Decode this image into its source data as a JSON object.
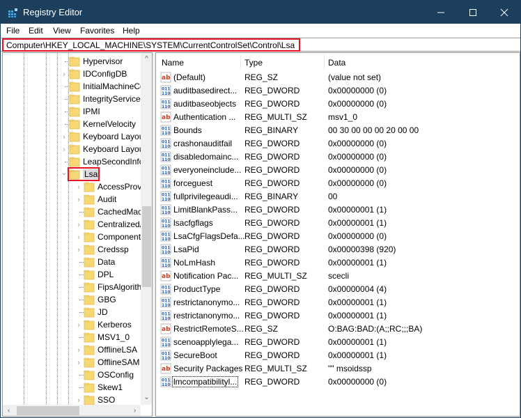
{
  "window": {
    "title": "Registry Editor",
    "controls": {
      "minimize": "minimize",
      "maximize": "maximize",
      "close": "close"
    }
  },
  "menu": [
    "File",
    "Edit",
    "View",
    "Favorites",
    "Help"
  ],
  "address": {
    "path": "Computer\\HKEY_LOCAL_MACHINE\\SYSTEM\\CurrentControlSet\\Control\\Lsa"
  },
  "tree": {
    "items": [
      {
        "label": "Hypervisor",
        "level": 0,
        "expander": "none"
      },
      {
        "label": "IDConfigDB",
        "level": 0,
        "expander": "collapsed"
      },
      {
        "label": "InitialMachineConfig",
        "level": 0,
        "expander": "none"
      },
      {
        "label": "IntegrityServices",
        "level": 0,
        "expander": "none"
      },
      {
        "label": "IPMI",
        "level": 0,
        "expander": "none"
      },
      {
        "label": "KernelVelocity",
        "level": 0,
        "expander": "none"
      },
      {
        "label": "Keyboard Layout",
        "level": 0,
        "expander": "collapsed"
      },
      {
        "label": "Keyboard Layouts",
        "level": 0,
        "expander": "collapsed"
      },
      {
        "label": "LeapSecondInformation",
        "level": 0,
        "expander": "none"
      },
      {
        "label": "Lsa",
        "level": 0,
        "expander": "expanded",
        "selected": true
      },
      {
        "label": "AccessProviders",
        "level": 1,
        "expander": "collapsed"
      },
      {
        "label": "Audit",
        "level": 1,
        "expander": "collapsed"
      },
      {
        "label": "CachedMachineNames",
        "level": 1,
        "expander": "none"
      },
      {
        "label": "CentralizedAccessPolicies",
        "level": 1,
        "expander": "collapsed"
      },
      {
        "label": "ComponentUpdates",
        "level": 1,
        "expander": "collapsed"
      },
      {
        "label": "Credssp",
        "level": 1,
        "expander": "collapsed"
      },
      {
        "label": "Data",
        "level": 1,
        "expander": "none"
      },
      {
        "label": "DPL",
        "level": 1,
        "expander": "none"
      },
      {
        "label": "FipsAlgorithmPolicy",
        "level": 1,
        "expander": "none"
      },
      {
        "label": "GBG",
        "level": 1,
        "expander": "none"
      },
      {
        "label": "JD",
        "level": 1,
        "expander": "none"
      },
      {
        "label": "Kerberos",
        "level": 1,
        "expander": "collapsed"
      },
      {
        "label": "MSV1_0",
        "level": 1,
        "expander": "none"
      },
      {
        "label": "OfflineLSA",
        "level": 1,
        "expander": "collapsed"
      },
      {
        "label": "OfflineSAM",
        "level": 1,
        "expander": "collapsed"
      },
      {
        "label": "OSConfig",
        "level": 1,
        "expander": "none"
      },
      {
        "label": "Skew1",
        "level": 1,
        "expander": "none"
      },
      {
        "label": "SSO",
        "level": 1,
        "expander": "collapsed"
      }
    ]
  },
  "values": {
    "columns": {
      "name": "Name",
      "type": "Type",
      "data": "Data"
    },
    "rows": [
      {
        "icon": "string",
        "name": "(Default)",
        "type": "REG_SZ",
        "data": "(value not set)"
      },
      {
        "icon": "binary",
        "name": "auditbasedirect...",
        "type": "REG_DWORD",
        "data": "0x00000000 (0)"
      },
      {
        "icon": "binary",
        "name": "auditbaseobjects",
        "type": "REG_DWORD",
        "data": "0x00000000 (0)"
      },
      {
        "icon": "string",
        "name": "Authentication ...",
        "type": "REG_MULTI_SZ",
        "data": "msv1_0"
      },
      {
        "icon": "binary",
        "name": "Bounds",
        "type": "REG_BINARY",
        "data": "00 30 00 00 00 20 00 00"
      },
      {
        "icon": "binary",
        "name": "crashonauditfail",
        "type": "REG_DWORD",
        "data": "0x00000000 (0)"
      },
      {
        "icon": "binary",
        "name": "disabledomainc...",
        "type": "REG_DWORD",
        "data": "0x00000000 (0)"
      },
      {
        "icon": "binary",
        "name": "everyoneinclude...",
        "type": "REG_DWORD",
        "data": "0x00000000 (0)"
      },
      {
        "icon": "binary",
        "name": "forceguest",
        "type": "REG_DWORD",
        "data": "0x00000000 (0)"
      },
      {
        "icon": "binary",
        "name": "fullprivilegeaudi...",
        "type": "REG_BINARY",
        "data": "00"
      },
      {
        "icon": "binary",
        "name": "LimitBlankPass...",
        "type": "REG_DWORD",
        "data": "0x00000001 (1)"
      },
      {
        "icon": "binary",
        "name": "lsacfgflags",
        "type": "REG_DWORD",
        "data": "0x00000001 (1)"
      },
      {
        "icon": "binary",
        "name": "LsaCfgFlagsDefa...",
        "type": "REG_DWORD",
        "data": "0x00000000 (0)"
      },
      {
        "icon": "binary",
        "name": "LsaPid",
        "type": "REG_DWORD",
        "data": "0x00000398 (920)"
      },
      {
        "icon": "binary",
        "name": "NoLmHash",
        "type": "REG_DWORD",
        "data": "0x00000001 (1)"
      },
      {
        "icon": "string",
        "name": "Notification Pac...",
        "type": "REG_MULTI_SZ",
        "data": "scecli"
      },
      {
        "icon": "binary",
        "name": "ProductType",
        "type": "REG_DWORD",
        "data": "0x00000004 (4)"
      },
      {
        "icon": "binary",
        "name": "restrictanonymo...",
        "type": "REG_DWORD",
        "data": "0x00000001 (1)"
      },
      {
        "icon": "binary",
        "name": "restrictanonymo...",
        "type": "REG_DWORD",
        "data": "0x00000001 (1)"
      },
      {
        "icon": "string",
        "name": "RestrictRemoteS...",
        "type": "REG_SZ",
        "data": "O:BAG:BAD:(A;;RC;;;BA)"
      },
      {
        "icon": "binary",
        "name": "scenoapplylega...",
        "type": "REG_DWORD",
        "data": "0x00000001 (1)"
      },
      {
        "icon": "binary",
        "name": "SecureBoot",
        "type": "REG_DWORD",
        "data": "0x00000001 (1)"
      },
      {
        "icon": "string",
        "name": "Security Packages",
        "type": "REG_MULTI_SZ",
        "data": "\"\" msoidssp"
      },
      {
        "icon": "binary",
        "name": "lmcompatibilityl...",
        "type": "REG_DWORD",
        "data": "0x00000000 (0)",
        "focused": true
      }
    ]
  },
  "colors": {
    "titlebar": "#1b3f5c",
    "highlight": "#e81123",
    "folder": "#f8d775"
  }
}
